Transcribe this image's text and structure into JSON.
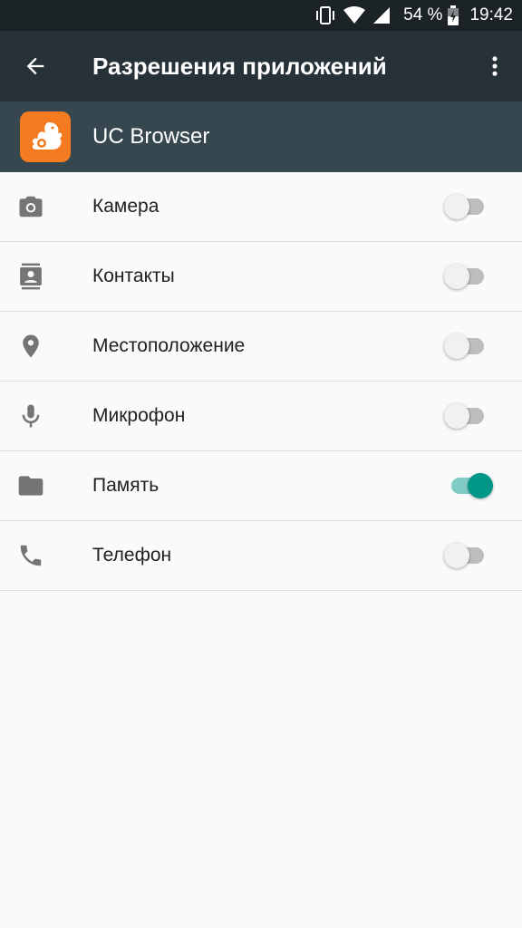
{
  "status_bar": {
    "battery": "54 %",
    "time": "19:42",
    "icons": [
      "vibrate-icon",
      "wifi-icon",
      "signal-icon",
      "battery-charging-icon"
    ]
  },
  "app_bar": {
    "title": "Разрешения приложений",
    "back_icon": "arrow-back-icon",
    "menu_icon": "more-vert-icon"
  },
  "app": {
    "name": "UC Browser",
    "icon": "uc-browser-squirrel-logo",
    "icon_color": "#f47b20"
  },
  "permissions": [
    {
      "label": "Камера",
      "icon": "camera-icon",
      "enabled": false
    },
    {
      "label": "Контакты",
      "icon": "contacts-icon",
      "enabled": false
    },
    {
      "label": "Местоположение",
      "icon": "location-icon",
      "enabled": false
    },
    {
      "label": "Микрофон",
      "icon": "microphone-icon",
      "enabled": false
    },
    {
      "label": "Память",
      "icon": "folder-icon",
      "enabled": true
    },
    {
      "label": "Телефон",
      "icon": "phone-icon",
      "enabled": false
    }
  ],
  "colors": {
    "status_bar": "#1c2327",
    "app_bar": "#263238",
    "app_header": "#37474f",
    "switch_on": "#009688",
    "switch_off": "#bdbdbd"
  }
}
